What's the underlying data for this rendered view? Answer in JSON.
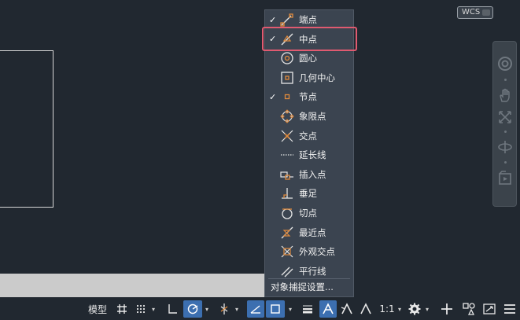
{
  "wcs_label": "WCS",
  "osnap_menu": {
    "items": [
      {
        "label": "端点",
        "checked": true,
        "icon": "endpoint-icon"
      },
      {
        "label": "中点",
        "checked": true,
        "icon": "midpoint-icon"
      },
      {
        "label": "圆心",
        "checked": false,
        "icon": "center-icon"
      },
      {
        "label": "几何中心",
        "checked": false,
        "icon": "geometric-center-icon"
      },
      {
        "label": "节点",
        "checked": true,
        "icon": "node-icon"
      },
      {
        "label": "象限点",
        "checked": false,
        "icon": "quadrant-icon"
      },
      {
        "label": "交点",
        "checked": false,
        "icon": "intersection-icon"
      },
      {
        "label": "延长线",
        "checked": false,
        "icon": "extension-icon"
      },
      {
        "label": "插入点",
        "checked": false,
        "icon": "insertion-icon"
      },
      {
        "label": "垂足",
        "checked": false,
        "icon": "perpendicular-icon"
      },
      {
        "label": "切点",
        "checked": false,
        "icon": "tangent-icon"
      },
      {
        "label": "最近点",
        "checked": false,
        "icon": "nearest-icon"
      },
      {
        "label": "外观交点",
        "checked": false,
        "icon": "apparent-intersection-icon"
      },
      {
        "label": "平行线",
        "checked": false,
        "icon": "parallel-icon"
      }
    ],
    "settings_label": "对象捕捉设置...",
    "check_glyph": "✓"
  },
  "status_bar": {
    "model_label": "模型",
    "scale_label": "1:1",
    "caret": "▾"
  },
  "colors": {
    "canvas": "#212830",
    "menu_bg": "#3b4450",
    "snap_marker": "#e08a3c",
    "highlight": "#e05a70",
    "active_blue": "#3c6fb0"
  }
}
